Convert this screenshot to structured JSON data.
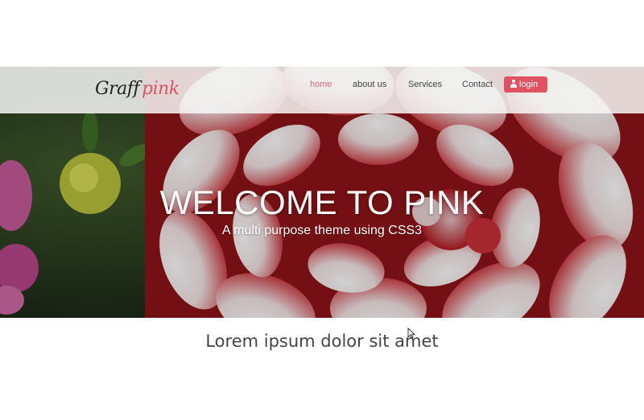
{
  "brand": {
    "part1": "Graff",
    "part2": "pink"
  },
  "nav": {
    "items": [
      {
        "label": "home",
        "active": true
      },
      {
        "label": "about us",
        "active": false
      },
      {
        "label": "Services",
        "active": false
      },
      {
        "label": "Contact",
        "active": false
      }
    ],
    "login_label": "login",
    "login_icon": "user-icon"
  },
  "hero": {
    "title": "WELCOME TO PINK",
    "subtitle": "A multi purpose theme using CSS3"
  },
  "section": {
    "heading": "Lorem ipsum dolor sit amet"
  },
  "colors": {
    "accent": "#e0525f",
    "active_link": "#e06a78",
    "text": "#444444"
  }
}
